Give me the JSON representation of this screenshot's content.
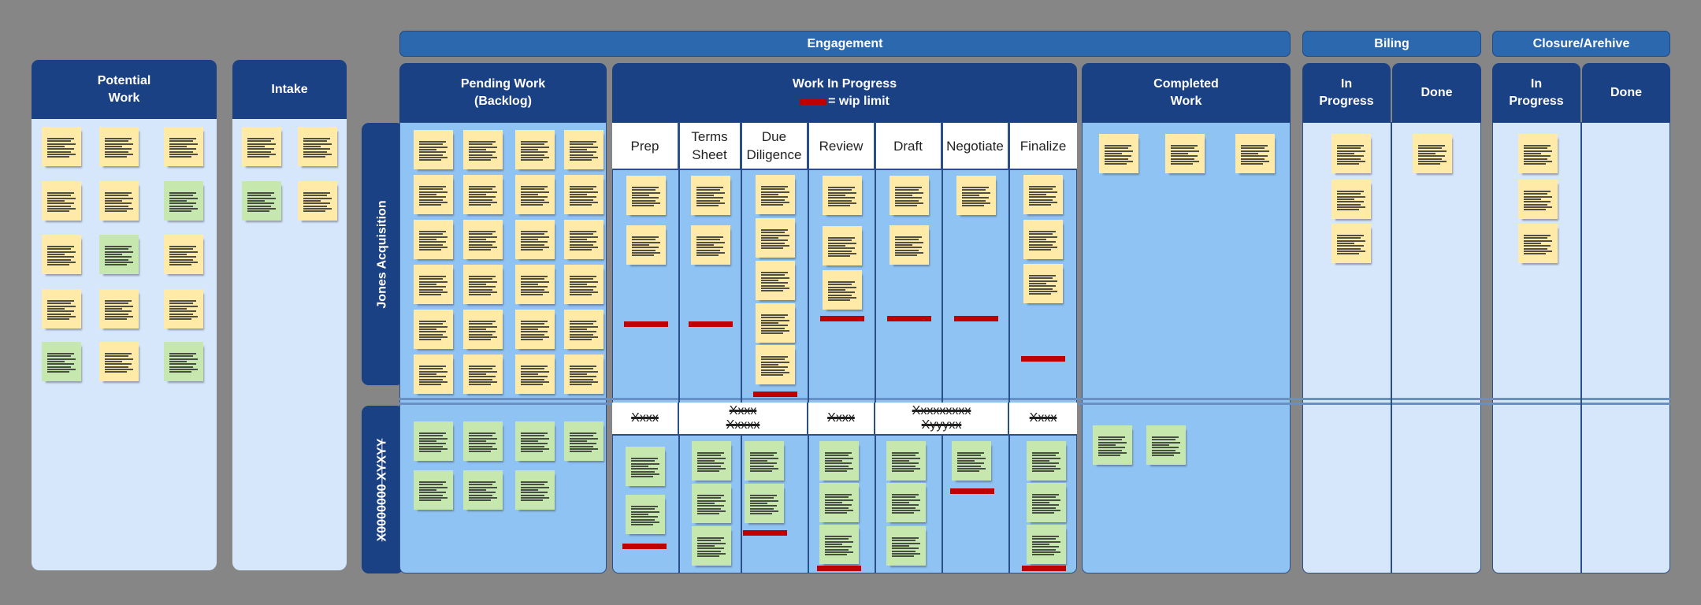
{
  "board": {
    "bands": {
      "engagement": "Engagement",
      "billing": "Biling",
      "closure": "Closure/Arehive"
    },
    "columns": {
      "potential_work": "Potential\nWork",
      "intake": "Intake",
      "pending_work": "Pending Work\n(Backlog)",
      "wip_title": "Work In Progress",
      "wip_legend": "= wip  limit",
      "completed_work": "Completed\nWork",
      "billing_in_progress": "In\nProgress",
      "billing_done": "Done",
      "closure_in_progress": "In\nProgress",
      "closure_done": "Done"
    },
    "wip_stages": [
      "Prep",
      "Terms\nSheet",
      "Due\nDiligence",
      "Review",
      "Draft",
      "Negotiate",
      "Finalize"
    ],
    "swimlanes": [
      {
        "label": "Jones Acquisition"
      },
      {
        "label": "X0000000  XYXYY"
      }
    ],
    "lane2_stage_labels": [
      {
        "lines": [
          "Xxxx"
        ]
      },
      {
        "lines": [
          "Xxxx",
          "Xxxxx"
        ]
      },
      {
        "lines": [
          "Xxxx"
        ]
      },
      {
        "lines": [
          "Xxxxxxxxx",
          "Xyyyxx"
        ]
      },
      {
        "lines": [
          "Xxxx"
        ]
      }
    ],
    "wip_limits": {
      "lane1": [
        3,
        3,
        5,
        3,
        3,
        3,
        4
      ],
      "lane2": [
        2,
        5,
        3,
        2,
        3
      ]
    },
    "cards": {
      "potential_work": [
        "yellow",
        "yellow",
        "yellow",
        "yellow",
        "yellow",
        "green",
        "yellow",
        "green",
        "yellow",
        "yellow",
        "yellow",
        "yellow",
        "green",
        "yellow",
        "green"
      ],
      "intake": [
        "yellow",
        "yellow",
        "green",
        "yellow"
      ],
      "pending_lane1": 24,
      "pending_lane2": 7,
      "wip_lane1": [
        2,
        2,
        5,
        3,
        2,
        1,
        3
      ],
      "wip_lane2": [
        2,
        5,
        3,
        4,
        3
      ],
      "completed_lane1": 3,
      "completed_lane2": 2,
      "billing_in_progress": 3,
      "billing_done": 1,
      "closure_in_progress": 3,
      "closure_done": 0
    },
    "colors": {
      "header": "#1b4185",
      "band": "#2b68ad",
      "wip_limit": "#c00000",
      "card_yellow": "#ffeaa8",
      "card_green": "#c6e8ae"
    }
  }
}
